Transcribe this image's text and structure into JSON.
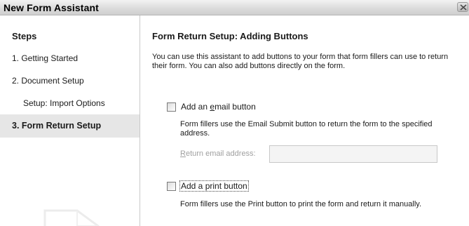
{
  "window": {
    "title": "New Form Assistant"
  },
  "sidebar": {
    "heading": "Steps",
    "steps": [
      {
        "label": "1. Getting Started",
        "active": false
      },
      {
        "label": "2. Document Setup",
        "active": false
      },
      {
        "label": "Setup: Import Options",
        "active": false,
        "sub": true
      },
      {
        "label": "3. Form Return Setup",
        "active": true
      }
    ]
  },
  "main": {
    "title": "Form Return Setup: Adding Buttons",
    "intro": "You can use this assistant to add buttons to your form that form fillers can use to return their form. You can also add buttons directly on the form.",
    "email_option": {
      "label_prefix": "Add an ",
      "label_accel": "e",
      "label_suffix": "mail button",
      "checked": false,
      "description": "Form fillers use the Email Submit button to return the form to the specified address.",
      "field_label_accel": "R",
      "field_label_rest": "eturn email address:",
      "field_value": "",
      "field_enabled": false
    },
    "print_option": {
      "label": "Add a print button",
      "checked": false,
      "description": "Form fillers use the Print button to print the form and return it manually."
    }
  },
  "colors": {
    "active_step_bg": "#e6e6e6",
    "disabled_text": "#a0a0a0",
    "titlebar": "#dcdcdc"
  },
  "icons": {
    "close": "close-icon",
    "watermark": "document-watermark-icon"
  }
}
